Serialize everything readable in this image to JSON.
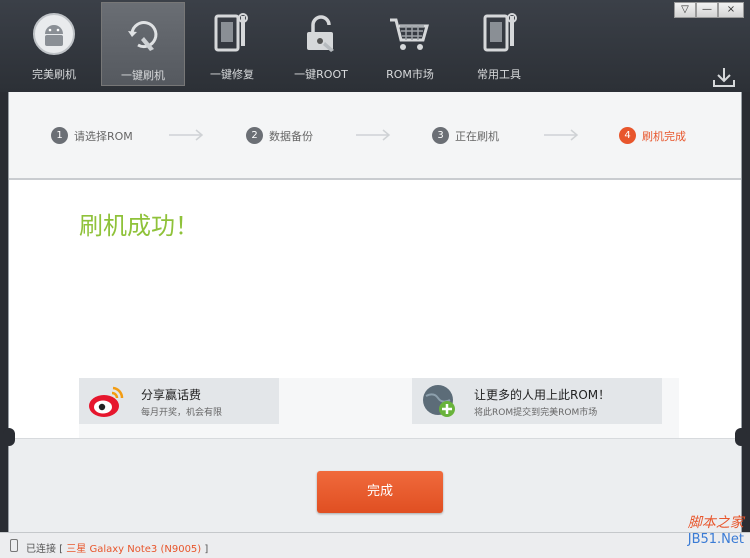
{
  "nav": {
    "items": [
      {
        "label": "完美刷机",
        "icon": "android-icon"
      },
      {
        "label": "一键刷机",
        "icon": "refresh-hand-icon"
      },
      {
        "label": "一键修复",
        "icon": "tablet-wrench-icon"
      },
      {
        "label": "一键ROOT",
        "icon": "unlock-icon"
      },
      {
        "label": "ROM市场",
        "icon": "cart-icon"
      },
      {
        "label": "常用工具",
        "icon": "tools-icon"
      }
    ]
  },
  "window": {
    "minimize": "—",
    "close": "×",
    "menu": "▽"
  },
  "steps": [
    {
      "num": "1",
      "label": "请选择ROM"
    },
    {
      "num": "2",
      "label": "数据备份"
    },
    {
      "num": "3",
      "label": "正在刷机"
    },
    {
      "num": "4",
      "label": "刷机完成"
    }
  ],
  "result": {
    "title": "刷机成功！"
  },
  "cards": {
    "share": {
      "title": "分享赢话费",
      "subtitle": "每月开奖，机会有限"
    },
    "rom": {
      "title": "让更多的人用上此ROM！",
      "subtitle": "将此ROM提交到完美ROM市场"
    }
  },
  "footer": {
    "done_label": "完成"
  },
  "status": {
    "prefix": "已连接 [",
    "device": " 三星 Galaxy Note3 (N9005)",
    "suffix": " ]"
  },
  "watermark": {
    "line1": "脚本之家",
    "line2": "JB51.Net"
  },
  "colors": {
    "accent": "#e8562c",
    "success": "#8fc23a"
  }
}
